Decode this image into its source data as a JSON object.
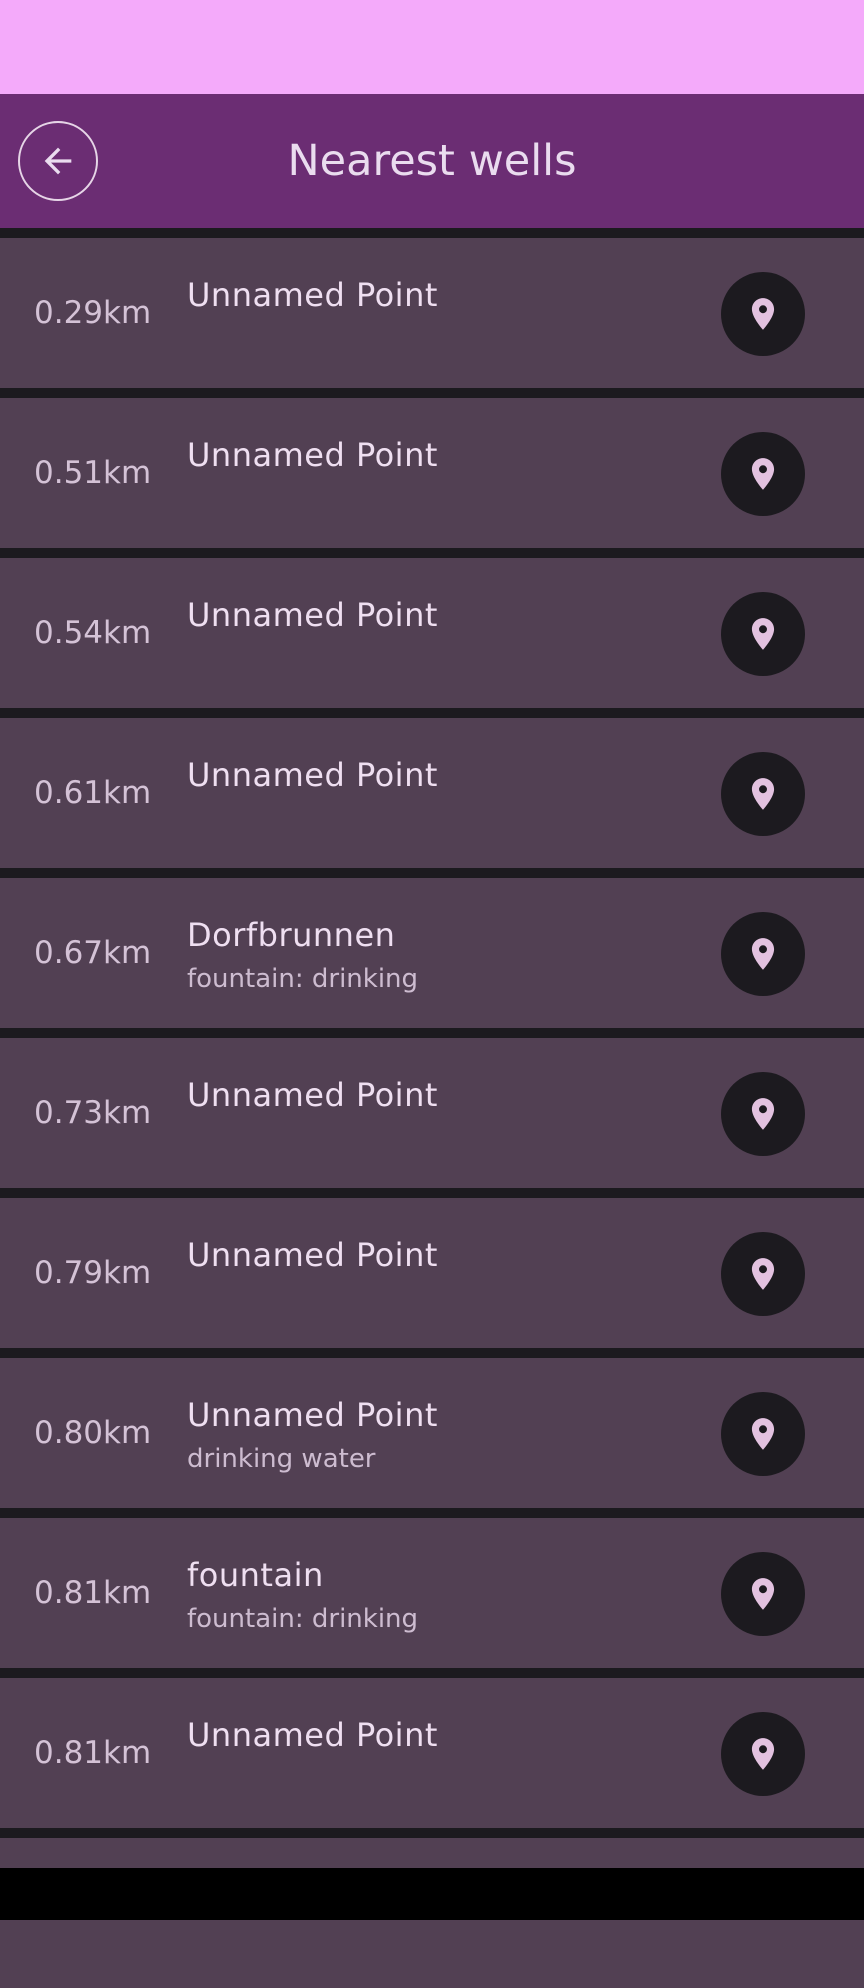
{
  "app_bar": {
    "title": "Nearest wells",
    "back_icon": "arrow-left-icon"
  },
  "colors": {
    "status_bar": "#f4aafa",
    "app_bar": "#6b2d73",
    "row_background": "#524053",
    "divider": "#1c1a1f",
    "pin_button": "#1c1a1f",
    "pin_icon": "#e3c2e0"
  },
  "wells": [
    {
      "distance": "0.29km",
      "name": "Unnamed Point",
      "detail": "",
      "icon": "map-pin-icon"
    },
    {
      "distance": "0.51km",
      "name": "Unnamed Point",
      "detail": "",
      "icon": "map-pin-icon"
    },
    {
      "distance": "0.54km",
      "name": "Unnamed Point",
      "detail": "",
      "icon": "map-pin-icon"
    },
    {
      "distance": "0.61km",
      "name": "Unnamed Point",
      "detail": "",
      "icon": "map-pin-icon"
    },
    {
      "distance": "0.67km",
      "name": "Dorfbrunnen",
      "detail": "fountain: drinking",
      "icon": "map-pin-icon"
    },
    {
      "distance": "0.73km",
      "name": "Unnamed Point",
      "detail": "",
      "icon": "map-pin-icon"
    },
    {
      "distance": "0.79km",
      "name": "Unnamed Point",
      "detail": "",
      "icon": "map-pin-icon"
    },
    {
      "distance": "0.80km",
      "name": "Unnamed Point",
      "detail": "drinking water",
      "icon": "map-pin-icon"
    },
    {
      "distance": "0.81km",
      "name": "fountain",
      "detail": "fountain: drinking",
      "icon": "map-pin-icon"
    },
    {
      "distance": "0.81km",
      "name": "Unnamed Point",
      "detail": "",
      "icon": "map-pin-icon"
    }
  ]
}
